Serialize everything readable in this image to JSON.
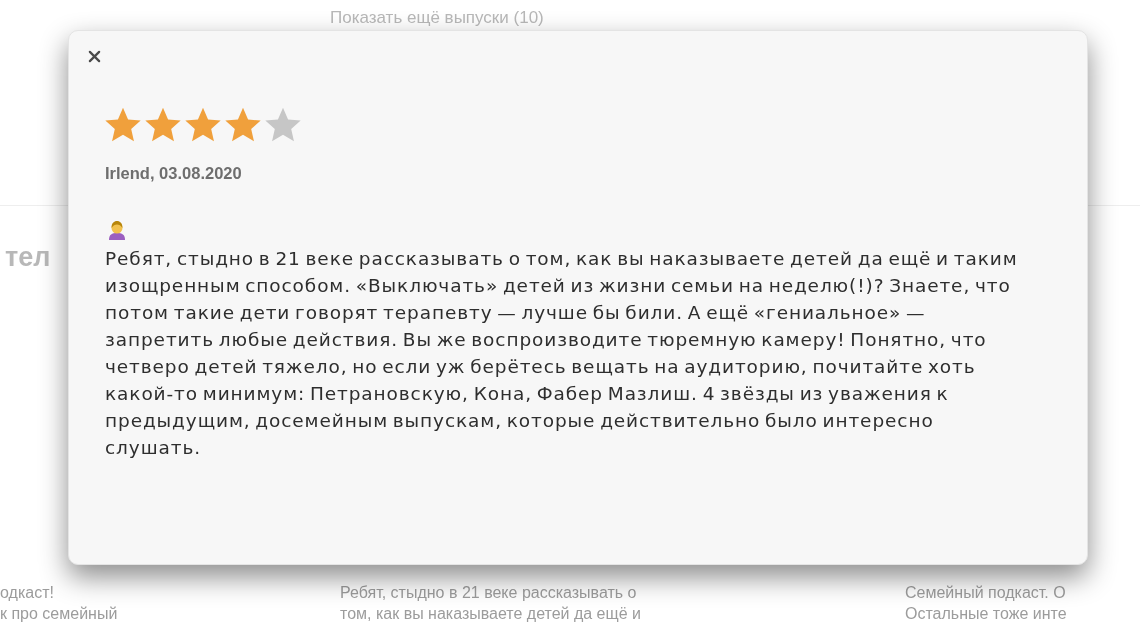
{
  "background": {
    "more_link": "Показать ещё выпуски (10)",
    "heading": "тел",
    "columns": [
      {
        "lines": [
          "одкаст!",
          "к про семейный"
        ]
      },
      {
        "lines": [
          "Ребят, стыдно в 21 веке рассказывать о",
          "том, как вы наказываете детей да ещё и"
        ]
      },
      {
        "lines": [
          "Семейный подкаст. О",
          "Остальные тоже инте"
        ]
      }
    ]
  },
  "review_dialog": {
    "stars": 4,
    "author_date": "Irlend, 03.08.2020",
    "text": "Ребят, стыдно в 21 веке рассказывать о том, как вы наказываете детей да ещё и таким изощренным способом. «Выключать» детей из жизни семьи на неделю(!)? Знаете, что потом такие дети говорят терапевту — лучше бы били. А ещё «гениальное» — запретить любые действия. Вы же воспроизводите тюремную камеру! Понятно, что четверо детей тяжело, но если уж берётесь вещать на аудиторию, почитайте хоть какой-то минимум: Петрановскую, Кона, Фабер Мазлиш. 4 звёзды из уважения к предыдущим, досемейным выпускам, которые действительно было интересно слушать."
  }
}
